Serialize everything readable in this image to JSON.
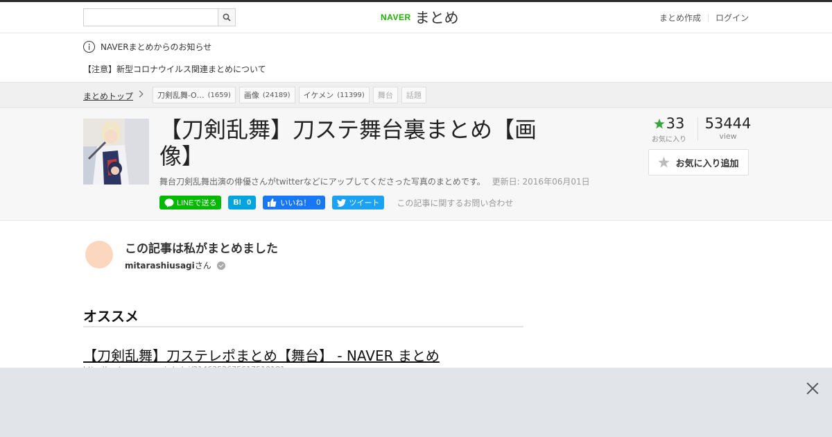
{
  "header": {
    "search_placeholder": "",
    "logo_brand": "NAVER",
    "logo_text": "まとめ",
    "create_label": "まとめ作成",
    "login_label": "ログイン"
  },
  "notice": {
    "heading": "NAVERまとめからのお知らせ",
    "link": "【注意】新型コロナウイルス関連まとめについて"
  },
  "breadcrumb": {
    "top": "まとめトップ",
    "tags": [
      {
        "label": "刀剣乱舞-O…",
        "count": "(1659)"
      },
      {
        "label": "画像",
        "count": "(24189)"
      },
      {
        "label": "イケメン",
        "count": "(11399)"
      },
      {
        "label": "舞台",
        "count": ""
      },
      {
        "label": "話題",
        "count": ""
      }
    ]
  },
  "article": {
    "title": "【刀剣乱舞】刀ステ舞台裏まとめ【画像】",
    "description": "舞台刀剣乱舞出演の俳優さんがtwitterなどにアップしてくださった写真のまとめです。",
    "updated": "更新日: 2016年06月01日",
    "share": {
      "line": "LINEで送る",
      "hatena_count": "0",
      "fb_label": "いいね！",
      "fb_count": "0",
      "tweet": "ツイート",
      "contact": "この記事に関するお問い合わせ"
    },
    "favorites": {
      "count": "33",
      "label": "お気に入り"
    },
    "views": {
      "count": "53444",
      "label": "view"
    },
    "add_favorite": "お気に入り追加"
  },
  "author": {
    "heading": "この記事は私がまとめました",
    "name": "mitarashiusagi",
    "suffix": "さん"
  },
  "recommend": {
    "heading": "オススメ",
    "link_title": "【刀剣乱舞】刀ステレポまとめ【舞台】 - NAVER まとめ",
    "link_url": "http://matome.naver.jp/odai/2146352675617510181"
  },
  "colors": {
    "naver_green": "#1db100",
    "line_green": "#00b900",
    "hatena_blue": "#00a4de",
    "fb_blue": "#1877f2",
    "twitter_blue": "#1da1f2",
    "star_green": "#3aa53a"
  }
}
